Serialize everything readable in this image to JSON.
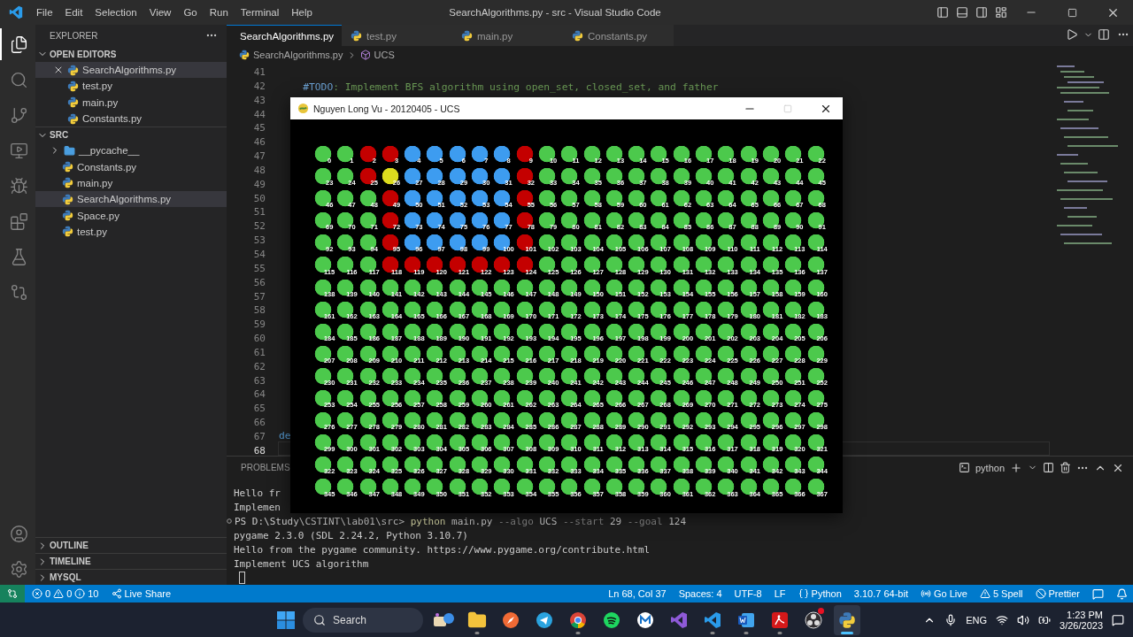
{
  "window": {
    "title": "SearchAlgorithms.py - src - Visual Studio Code"
  },
  "menu": [
    "File",
    "Edit",
    "Selection",
    "View",
    "Go",
    "Run",
    "Terminal",
    "Help"
  ],
  "activity_bar": [
    {
      "kind": "explorer",
      "selected": true
    },
    {
      "kind": "search",
      "selected": false
    },
    {
      "kind": "source-control",
      "selected": false
    },
    {
      "kind": "remote",
      "selected": false
    },
    {
      "kind": "debug",
      "selected": false
    },
    {
      "kind": "extensions",
      "selected": false
    },
    {
      "kind": "testing",
      "selected": false
    },
    {
      "kind": "git",
      "selected": false
    }
  ],
  "activity_bottom": [
    {
      "kind": "account"
    },
    {
      "kind": "settings"
    }
  ],
  "sidebar": {
    "title": "EXPLORER",
    "sections": [
      {
        "title": "OPEN EDITORS",
        "expanded": true,
        "items": [
          {
            "label": "SearchAlgorithms.py",
            "kind": "file",
            "selected": true,
            "closable": true
          },
          {
            "label": "test.py",
            "kind": "file",
            "selected": false,
            "closable": false
          },
          {
            "label": "main.py",
            "kind": "file",
            "selected": false,
            "closable": false
          },
          {
            "label": "Constants.py",
            "kind": "file",
            "selected": false,
            "closable": false
          }
        ]
      },
      {
        "title": "SRC",
        "expanded": true,
        "items": [
          {
            "label": "__pycache__",
            "kind": "folder",
            "selected": false,
            "closable": false
          },
          {
            "label": "Constants.py",
            "kind": "file",
            "selected": false,
            "closable": false
          },
          {
            "label": "main.py",
            "kind": "file",
            "selected": false,
            "closable": false
          },
          {
            "label": "SearchAlgorithms.py",
            "kind": "file",
            "selected": true,
            "closable": false
          },
          {
            "label": "Space.py",
            "kind": "file",
            "selected": false,
            "closable": false
          },
          {
            "label": "test.py",
            "kind": "file",
            "selected": false,
            "closable": false
          }
        ]
      }
    ],
    "bottom_sections": [
      {
        "title": "OUTLINE",
        "expanded": false
      },
      {
        "title": "TIMELINE",
        "expanded": false
      },
      {
        "title": "MYSQL",
        "expanded": false
      }
    ]
  },
  "tabs": [
    {
      "label": "SearchAlgorithms.py",
      "selected": true
    },
    {
      "label": "test.py",
      "selected": false
    },
    {
      "label": "main.py",
      "selected": false
    },
    {
      "label": "Constants.py",
      "selected": false
    }
  ],
  "breadcrumb": {
    "file": "SearchAlgorithms.py",
    "symbol": "UCS"
  },
  "code_lines": [
    {
      "number": "41",
      "current": false
    },
    {
      "number": "42",
      "current": false,
      "segments": [
        {
          "text": "    #TODO",
          "kind": "todo"
        },
        {
          "text": ": Implement BFS algorithm using open_set, closed_set, and father",
          "kind": "comment"
        }
      ]
    },
    {
      "number": "43",
      "current": false
    },
    {
      "number": "44",
      "current": false
    },
    {
      "number": "45",
      "current": false
    },
    {
      "number": "46",
      "current": false
    },
    {
      "number": "47",
      "current": false
    },
    {
      "number": "48",
      "current": false
    },
    {
      "number": "49",
      "current": false
    },
    {
      "number": "50",
      "current": false
    },
    {
      "number": "51",
      "current": false
    },
    {
      "number": "52",
      "current": false
    },
    {
      "number": "53",
      "current": false
    },
    {
      "number": "54",
      "current": false
    },
    {
      "number": "55",
      "current": false
    },
    {
      "number": "56",
      "current": false
    },
    {
      "number": "57",
      "current": false
    },
    {
      "number": "58",
      "current": false
    },
    {
      "number": "59",
      "current": false
    },
    {
      "number": "60",
      "current": false
    },
    {
      "number": "61",
      "current": false
    },
    {
      "number": "62",
      "current": false
    },
    {
      "number": "63",
      "current": false
    },
    {
      "number": "64",
      "current": false
    },
    {
      "number": "65",
      "current": false
    },
    {
      "number": "66",
      "current": false
    },
    {
      "number": "67",
      "current": false,
      "segments": [
        {
          "text": "de",
          "kind": "keyword"
        }
      ]
    },
    {
      "number": "68",
      "current": true
    }
  ],
  "panel": {
    "tabs": [
      {
        "label": "PROBLEMS",
        "selected": false
      }
    ],
    "terminal_name": "python",
    "lines": [
      {
        "kind": "plain",
        "segments": [
          {
            "text": "Hello fr",
            "kind": "plain"
          }
        ]
      },
      {
        "kind": "plain",
        "segments": [
          {
            "text": "Implemen",
            "kind": "plain"
          }
        ]
      },
      {
        "kind": "prompt",
        "segments": [
          {
            "text": "PS D:\\Study\\CSTINT\\lab01\\src> ",
            "kind": "plain"
          },
          {
            "text": "python",
            "kind": "command"
          },
          {
            "text": " main.py ",
            "kind": "plain"
          },
          {
            "text": "--algo",
            "kind": "flag"
          },
          {
            "text": " UCS ",
            "kind": "plain"
          },
          {
            "text": "--start",
            "kind": "flag"
          },
          {
            "text": " 29 ",
            "kind": "plain"
          },
          {
            "text": "--goal",
            "kind": "flag"
          },
          {
            "text": " 124",
            "kind": "plain"
          }
        ]
      },
      {
        "kind": "plain",
        "segments": [
          {
            "text": "pygame 2.3.0 (SDL 2.24.2, Python 3.10.7)",
            "kind": "plain"
          }
        ]
      },
      {
        "kind": "plain",
        "segments": [
          {
            "text": "Hello from the pygame community. https://www.pygame.org/contribute.html",
            "kind": "plain"
          }
        ]
      },
      {
        "kind": "plain",
        "segments": [
          {
            "text": "Implement UCS algorithm",
            "kind": "plain"
          }
        ]
      },
      {
        "kind": "cursor"
      }
    ]
  },
  "status_bar": {
    "left": [
      {
        "kind": "remote"
      },
      {
        "kind": "problems",
        "errors": "0",
        "warnings": "0",
        "infos": "10"
      },
      {
        "kind": "liveshare",
        "text": "Live Share"
      }
    ],
    "right": [
      {
        "kind": "text",
        "text": "Ln 68, Col 37"
      },
      {
        "kind": "text",
        "text": "Spaces: 4"
      },
      {
        "kind": "text",
        "text": "UTF-8"
      },
      {
        "kind": "text",
        "text": "LF"
      },
      {
        "kind": "language",
        "text": "Python"
      },
      {
        "kind": "text",
        "text": "3.10.7 64-bit"
      },
      {
        "kind": "golive",
        "text": "Go Live"
      },
      {
        "kind": "spell",
        "text": "5 Spell"
      },
      {
        "kind": "prettier",
        "text": "Prettier"
      },
      {
        "kind": "feedback"
      },
      {
        "kind": "bell"
      }
    ]
  },
  "taskbar": {
    "search": {
      "placeholder": "Search"
    },
    "apps": [
      {
        "kind": "widgets",
        "running": false,
        "selected": false,
        "badge": false
      },
      {
        "kind": "files",
        "running": true,
        "selected": false,
        "badge": false
      },
      {
        "kind": "compass",
        "running": false,
        "selected": false,
        "badge": false
      },
      {
        "kind": "telegram",
        "running": false,
        "selected": false,
        "badge": false
      },
      {
        "kind": "chrome",
        "running": true,
        "selected": false,
        "badge": false
      },
      {
        "kind": "spotify",
        "running": false,
        "selected": false,
        "badge": false
      },
      {
        "kind": "mail",
        "running": false,
        "selected": false,
        "badge": false
      },
      {
        "kind": "visual-studio",
        "running": false,
        "selected": false,
        "badge": false
      },
      {
        "kind": "vscode",
        "running": true,
        "selected": false,
        "badge": false
      },
      {
        "kind": "word",
        "running": true,
        "selected": false,
        "badge": false
      },
      {
        "kind": "acrobat",
        "running": true,
        "selected": false,
        "badge": false
      },
      {
        "kind": "obs",
        "running": false,
        "selected": false,
        "badge": true
      },
      {
        "kind": "python",
        "running": true,
        "selected": true,
        "badge": false
      }
    ],
    "language": "ENG",
    "time": "1:23 PM",
    "date": "3/26/2023"
  },
  "pygame_window": {
    "title": "Nguyen Long Vu - 20120405 - UCS",
    "buttons": [
      {
        "kind": "minimize",
        "disabled": false
      },
      {
        "kind": "maximize",
        "disabled": true
      },
      {
        "kind": "close",
        "disabled": false
      }
    ],
    "nodes": [
      {
        "label": "0",
        "color": "#4cc94c"
      },
      {
        "label": "1",
        "color": "#4cc94c"
      },
      {
        "label": "2",
        "color": "#c40000"
      },
      {
        "label": "3",
        "color": "#c40000"
      },
      {
        "label": "4",
        "color": "#3d9cf0"
      },
      {
        "label": "5",
        "color": "#3d9cf0"
      },
      {
        "label": "6",
        "color": "#3d9cf0"
      },
      {
        "label": "7",
        "color": "#3d9cf0"
      },
      {
        "label": "8",
        "color": "#3d9cf0"
      },
      {
        "label": "9",
        "color": "#c40000"
      },
      {
        "label": "10",
        "color": "#4cc94c"
      },
      {
        "label": "11",
        "color": "#4cc94c"
      },
      {
        "label": "12",
        "color": "#4cc94c"
      },
      {
        "label": "13",
        "color": "#4cc94c"
      },
      {
        "label": "14",
        "color": "#4cc94c"
      },
      {
        "label": "15",
        "color": "#4cc94c"
      },
      {
        "label": "16",
        "color": "#4cc94c"
      },
      {
        "label": "17",
        "color": "#4cc94c"
      },
      {
        "label": "18",
        "color": "#4cc94c"
      },
      {
        "label": "19",
        "color": "#4cc94c"
      },
      {
        "label": "20",
        "color": "#4cc94c"
      },
      {
        "label": "21",
        "color": "#4cc94c"
      },
      {
        "label": "22",
        "color": "#4cc94c"
      },
      {
        "label": "23",
        "color": "#4cc94c"
      },
      {
        "label": "24",
        "color": "#4cc94c"
      },
      {
        "label": "25",
        "color": "#c40000"
      },
      {
        "label": "26",
        "color": "#dcdc1e"
      },
      {
        "label": "27",
        "color": "#3d9cf0"
      },
      {
        "label": "28",
        "color": "#3d9cf0"
      },
      {
        "label": "29",
        "color": "#3d9cf0"
      },
      {
        "label": "30",
        "color": "#3d9cf0"
      },
      {
        "label": "31",
        "color": "#3d9cf0"
      },
      {
        "label": "32",
        "color": "#c40000"
      },
      {
        "label": "33",
        "color": "#4cc94c"
      },
      {
        "label": "34",
        "color": "#4cc94c"
      },
      {
        "label": "35",
        "color": "#4cc94c"
      },
      {
        "label": "36",
        "color": "#4cc94c"
      },
      {
        "label": "37",
        "color": "#4cc94c"
      },
      {
        "label": "38",
        "color": "#4cc94c"
      },
      {
        "label": "39",
        "color": "#4cc94c"
      },
      {
        "label": "40",
        "color": "#4cc94c"
      },
      {
        "label": "41",
        "color": "#4cc94c"
      },
      {
        "label": "42",
        "color": "#4cc94c"
      },
      {
        "label": "43",
        "color": "#4cc94c"
      },
      {
        "label": "44",
        "color": "#4cc94c"
      },
      {
        "label": "45",
        "color": "#4cc94c"
      },
      {
        "label": "46",
        "color": "#4cc94c"
      },
      {
        "label": "47",
        "color": "#4cc94c"
      },
      {
        "label": "48",
        "color": "#4cc94c"
      },
      {
        "label": "49",
        "color": "#c40000"
      },
      {
        "label": "50",
        "color": "#3d9cf0"
      },
      {
        "label": "51",
        "color": "#3d9cf0"
      },
      {
        "label": "52",
        "color": "#3d9cf0"
      },
      {
        "label": "53",
        "color": "#3d9cf0"
      },
      {
        "label": "54",
        "color": "#3d9cf0"
      },
      {
        "label": "55",
        "color": "#c40000"
      },
      {
        "label": "56",
        "color": "#4cc94c"
      },
      {
        "label": "57",
        "color": "#4cc94c"
      },
      {
        "label": "58",
        "color": "#4cc94c"
      },
      {
        "label": "59",
        "color": "#4cc94c"
      },
      {
        "label": "60",
        "color": "#4cc94c"
      },
      {
        "label": "61",
        "color": "#4cc94c"
      },
      {
        "label": "62",
        "color": "#4cc94c"
      },
      {
        "label": "63",
        "color": "#4cc94c"
      },
      {
        "label": "64",
        "color": "#4cc94c"
      },
      {
        "label": "65",
        "color": "#4cc94c"
      },
      {
        "label": "66",
        "color": "#4cc94c"
      },
      {
        "label": "67",
        "color": "#4cc94c"
      },
      {
        "label": "68",
        "color": "#4cc94c"
      },
      {
        "label": "69",
        "color": "#4cc94c"
      },
      {
        "label": "70",
        "color": "#4cc94c"
      },
      {
        "label": "71",
        "color": "#4cc94c"
      },
      {
        "label": "72",
        "color": "#c40000"
      },
      {
        "label": "73",
        "color": "#3d9cf0"
      },
      {
        "label": "74",
        "color": "#3d9cf0"
      },
      {
        "label": "75",
        "color": "#3d9cf0"
      },
      {
        "label": "76",
        "color": "#3d9cf0"
      },
      {
        "label": "77",
        "color": "#3d9cf0"
      },
      {
        "label": "78",
        "color": "#c40000"
      },
      {
        "label": "79",
        "color": "#4cc94c"
      },
      {
        "label": "80",
        "color": "#4cc94c"
      },
      {
        "label": "81",
        "color": "#4cc94c"
      },
      {
        "label": "82",
        "color": "#4cc94c"
      },
      {
        "label": "83",
        "color": "#4cc94c"
      },
      {
        "label": "84",
        "color": "#4cc94c"
      },
      {
        "label": "85",
        "color": "#4cc94c"
      },
      {
        "label": "86",
        "color": "#4cc94c"
      },
      {
        "label": "87",
        "color": "#4cc94c"
      },
      {
        "label": "88",
        "color": "#4cc94c"
      },
      {
        "label": "89",
        "color": "#4cc94c"
      },
      {
        "label": "90",
        "color": "#4cc94c"
      },
      {
        "label": "91",
        "color": "#4cc94c"
      },
      {
        "label": "92",
        "color": "#4cc94c"
      },
      {
        "label": "93",
        "color": "#4cc94c"
      },
      {
        "label": "94",
        "color": "#4cc94c"
      },
      {
        "label": "95",
        "color": "#c40000"
      },
      {
        "label": "96",
        "color": "#3d9cf0"
      },
      {
        "label": "97",
        "color": "#3d9cf0"
      },
      {
        "label": "98",
        "color": "#3d9cf0"
      },
      {
        "label": "99",
        "color": "#3d9cf0"
      },
      {
        "label": "100",
        "color": "#3d9cf0"
      },
      {
        "label": "101",
        "color": "#c40000"
      },
      {
        "label": "102",
        "color": "#4cc94c"
      },
      {
        "label": "103",
        "color": "#4cc94c"
      },
      {
        "label": "104",
        "color": "#4cc94c"
      },
      {
        "label": "105",
        "color": "#4cc94c"
      },
      {
        "label": "106",
        "color": "#4cc94c"
      },
      {
        "label": "107",
        "color": "#4cc94c"
      },
      {
        "label": "108",
        "color": "#4cc94c"
      },
      {
        "label": "109",
        "color": "#4cc94c"
      },
      {
        "label": "110",
        "color": "#4cc94c"
      },
      {
        "label": "111",
        "color": "#4cc94c"
      },
      {
        "label": "112",
        "color": "#4cc94c"
      },
      {
        "label": "113",
        "color": "#4cc94c"
      },
      {
        "label": "114",
        "color": "#4cc94c"
      },
      {
        "label": "115",
        "color": "#4cc94c"
      },
      {
        "label": "116",
        "color": "#4cc94c"
      },
      {
        "label": "117",
        "color": "#4cc94c"
      },
      {
        "label": "118",
        "color": "#c40000"
      },
      {
        "label": "119",
        "color": "#c40000"
      },
      {
        "label": "120",
        "color": "#c40000"
      },
      {
        "label": "121",
        "color": "#c40000"
      },
      {
        "label": "122",
        "color": "#c40000"
      },
      {
        "label": "123",
        "color": "#c40000"
      },
      {
        "label": "124",
        "color": "#c40000"
      },
      {
        "label": "125",
        "color": "#4cc94c"
      },
      {
        "label": "126",
        "color": "#4cc94c"
      },
      {
        "label": "127",
        "color": "#4cc94c"
      },
      {
        "label": "128",
        "color": "#4cc94c"
      },
      {
        "label": "129",
        "color": "#4cc94c"
      },
      {
        "label": "130",
        "color": "#4cc94c"
      },
      {
        "label": "131",
        "color": "#4cc94c"
      },
      {
        "label": "132",
        "color": "#4cc94c"
      },
      {
        "label": "133",
        "color": "#4cc94c"
      },
      {
        "label": "134",
        "color": "#4cc94c"
      },
      {
        "label": "135",
        "color": "#4cc94c"
      },
      {
        "label": "136",
        "color": "#4cc94c"
      },
      {
        "label": "137",
        "color": "#4cc94c"
      },
      {
        "label": "138",
        "color": "#4cc94c"
      },
      {
        "label": "139",
        "color": "#4cc94c"
      },
      {
        "label": "140",
        "color": "#4cc94c"
      },
      {
        "label": "141",
        "color": "#4cc94c"
      },
      {
        "label": "142",
        "color": "#4cc94c"
      },
      {
        "label": "143",
        "color": "#4cc94c"
      },
      {
        "label": "144",
        "color": "#4cc94c"
      },
      {
        "label": "145",
        "color": "#4cc94c"
      },
      {
        "label": "146",
        "color": "#4cc94c"
      },
      {
        "label": "147",
        "color": "#4cc94c"
      },
      {
        "label": "148",
        "color": "#4cc94c"
      },
      {
        "label": "149",
        "color": "#4cc94c"
      },
      {
        "label": "150",
        "color": "#4cc94c"
      },
      {
        "label": "151",
        "color": "#4cc94c"
      },
      {
        "label": "152",
        "color": "#4cc94c"
      },
      {
        "label": "153",
        "color": "#4cc94c"
      },
      {
        "label": "154",
        "color": "#4cc94c"
      },
      {
        "label": "155",
        "color": "#4cc94c"
      },
      {
        "label": "156",
        "color": "#4cc94c"
      },
      {
        "label": "157",
        "color": "#4cc94c"
      },
      {
        "label": "158",
        "color": "#4cc94c"
      },
      {
        "label": "159",
        "color": "#4cc94c"
      },
      {
        "label": "160",
        "color": "#4cc94c"
      },
      {
        "label": "161",
        "color": "#4cc94c"
      },
      {
        "label": "162",
        "color": "#4cc94c"
      },
      {
        "label": "163",
        "color": "#4cc94c"
      },
      {
        "label": "164",
        "color": "#4cc94c"
      },
      {
        "label": "165",
        "color": "#4cc94c"
      },
      {
        "label": "166",
        "color": "#4cc94c"
      },
      {
        "label": "167",
        "color": "#4cc94c"
      },
      {
        "label": "168",
        "color": "#4cc94c"
      },
      {
        "label": "169",
        "color": "#4cc94c"
      },
      {
        "label": "170",
        "color": "#4cc94c"
      },
      {
        "label": "171",
        "color": "#4cc94c"
      },
      {
        "label": "172",
        "color": "#4cc94c"
      },
      {
        "label": "173",
        "color": "#4cc94c"
      },
      {
        "label": "174",
        "color": "#4cc94c"
      },
      {
        "label": "175",
        "color": "#4cc94c"
      },
      {
        "label": "176",
        "color": "#4cc94c"
      },
      {
        "label": "177",
        "color": "#4cc94c"
      },
      {
        "label": "178",
        "color": "#4cc94c"
      },
      {
        "label": "179",
        "color": "#4cc94c"
      },
      {
        "label": "180",
        "color": "#4cc94c"
      },
      {
        "label": "181",
        "color": "#4cc94c"
      },
      {
        "label": "182",
        "color": "#4cc94c"
      },
      {
        "label": "183",
        "color": "#4cc94c"
      },
      {
        "label": "184",
        "color": "#4cc94c"
      },
      {
        "label": "185",
        "color": "#4cc94c"
      },
      {
        "label": "186",
        "color": "#4cc94c"
      },
      {
        "label": "187",
        "color": "#4cc94c"
      },
      {
        "label": "188",
        "color": "#4cc94c"
      },
      {
        "label": "189",
        "color": "#4cc94c"
      },
      {
        "label": "190",
        "color": "#4cc94c"
      },
      {
        "label": "191",
        "color": "#4cc94c"
      },
      {
        "label": "192",
        "color": "#4cc94c"
      },
      {
        "label": "193",
        "color": "#4cc94c"
      },
      {
        "label": "194",
        "color": "#4cc94c"
      },
      {
        "label": "195",
        "color": "#4cc94c"
      },
      {
        "label": "196",
        "color": "#4cc94c"
      },
      {
        "label": "197",
        "color": "#4cc94c"
      },
      {
        "label": "198",
        "color": "#4cc94c"
      },
      {
        "label": "199",
        "color": "#4cc94c"
      },
      {
        "label": "200",
        "color": "#4cc94c"
      },
      {
        "label": "201",
        "color": "#4cc94c"
      },
      {
        "label": "202",
        "color": "#4cc94c"
      },
      {
        "label": "203",
        "color": "#4cc94c"
      },
      {
        "label": "204",
        "color": "#4cc94c"
      },
      {
        "label": "205",
        "color": "#4cc94c"
      },
      {
        "label": "206",
        "color": "#4cc94c"
      },
      {
        "label": "207",
        "color": "#4cc94c"
      },
      {
        "label": "208",
        "color": "#4cc94c"
      },
      {
        "label": "209",
        "color": "#4cc94c"
      },
      {
        "label": "210",
        "color": "#4cc94c"
      },
      {
        "label": "211",
        "color": "#4cc94c"
      },
      {
        "label": "212",
        "color": "#4cc94c"
      },
      {
        "label": "213",
        "color": "#4cc94c"
      },
      {
        "label": "214",
        "color": "#4cc94c"
      },
      {
        "label": "215",
        "color": "#4cc94c"
      },
      {
        "label": "216",
        "color": "#4cc94c"
      },
      {
        "label": "217",
        "color": "#4cc94c"
      },
      {
        "label": "218",
        "color": "#4cc94c"
      },
      {
        "label": "219",
        "color": "#4cc94c"
      },
      {
        "label": "220",
        "color": "#4cc94c"
      },
      {
        "label": "221",
        "color": "#4cc94c"
      },
      {
        "label": "222",
        "color": "#4cc94c"
      },
      {
        "label": "223",
        "color": "#4cc94c"
      },
      {
        "label": "224",
        "color": "#4cc94c"
      },
      {
        "label": "225",
        "color": "#4cc94c"
      },
      {
        "label": "226",
        "color": "#4cc94c"
      },
      {
        "label": "227",
        "color": "#4cc94c"
      },
      {
        "label": "228",
        "color": "#4cc94c"
      },
      {
        "label": "229",
        "color": "#4cc94c"
      },
      {
        "label": "230",
        "color": "#4cc94c"
      },
      {
        "label": "231",
        "color": "#4cc94c"
      },
      {
        "label": "232",
        "color": "#4cc94c"
      },
      {
        "label": "233",
        "color": "#4cc94c"
      },
      {
        "label": "234",
        "color": "#4cc94c"
      },
      {
        "label": "235",
        "color": "#4cc94c"
      },
      {
        "label": "236",
        "color": "#4cc94c"
      },
      {
        "label": "237",
        "color": "#4cc94c"
      },
      {
        "label": "238",
        "color": "#4cc94c"
      },
      {
        "label": "239",
        "color": "#4cc94c"
      },
      {
        "label": "240",
        "color": "#4cc94c"
      },
      {
        "label": "241",
        "color": "#4cc94c"
      },
      {
        "label": "242",
        "color": "#4cc94c"
      },
      {
        "label": "243",
        "color": "#4cc94c"
      },
      {
        "label": "244",
        "color": "#4cc94c"
      },
      {
        "label": "245",
        "color": "#4cc94c"
      },
      {
        "label": "246",
        "color": "#4cc94c"
      },
      {
        "label": "247",
        "color": "#4cc94c"
      },
      {
        "label": "248",
        "color": "#4cc94c"
      },
      {
        "label": "249",
        "color": "#4cc94c"
      },
      {
        "label": "250",
        "color": "#4cc94c"
      },
      {
        "label": "251",
        "color": "#4cc94c"
      },
      {
        "label": "252",
        "color": "#4cc94c"
      },
      {
        "label": "253",
        "color": "#4cc94c"
      },
      {
        "label": "254",
        "color": "#4cc94c"
      },
      {
        "label": "255",
        "color": "#4cc94c"
      },
      {
        "label": "256",
        "color": "#4cc94c"
      },
      {
        "label": "257",
        "color": "#4cc94c"
      },
      {
        "label": "258",
        "color": "#4cc94c"
      },
      {
        "label": "259",
        "color": "#4cc94c"
      },
      {
        "label": "260",
        "color": "#4cc94c"
      },
      {
        "label": "261",
        "color": "#4cc94c"
      },
      {
        "label": "262",
        "color": "#4cc94c"
      },
      {
        "label": "263",
        "color": "#4cc94c"
      },
      {
        "label": "264",
        "color": "#4cc94c"
      },
      {
        "label": "265",
        "color": "#4cc94c"
      },
      {
        "label": "266",
        "color": "#4cc94c"
      },
      {
        "label": "267",
        "color": "#4cc94c"
      },
      {
        "label": "268",
        "color": "#4cc94c"
      },
      {
        "label": "269",
        "color": "#4cc94c"
      },
      {
        "label": "270",
        "color": "#4cc94c"
      },
      {
        "label": "271",
        "color": "#4cc94c"
      },
      {
        "label": "272",
        "color": "#4cc94c"
      },
      {
        "label": "273",
        "color": "#4cc94c"
      },
      {
        "label": "274",
        "color": "#4cc94c"
      },
      {
        "label": "275",
        "color": "#4cc94c"
      },
      {
        "label": "276",
        "color": "#4cc94c"
      },
      {
        "label": "277",
        "color": "#4cc94c"
      },
      {
        "label": "278",
        "color": "#4cc94c"
      },
      {
        "label": "279",
        "color": "#4cc94c"
      },
      {
        "label": "280",
        "color": "#4cc94c"
      },
      {
        "label": "281",
        "color": "#4cc94c"
      },
      {
        "label": "282",
        "color": "#4cc94c"
      },
      {
        "label": "283",
        "color": "#4cc94c"
      },
      {
        "label": "284",
        "color": "#4cc94c"
      },
      {
        "label": "285",
        "color": "#4cc94c"
      },
      {
        "label": "286",
        "color": "#4cc94c"
      },
      {
        "label": "287",
        "color": "#4cc94c"
      },
      {
        "label": "288",
        "color": "#4cc94c"
      },
      {
        "label": "289",
        "color": "#4cc94c"
      },
      {
        "label": "290",
        "color": "#4cc94c"
      },
      {
        "label": "291",
        "color": "#4cc94c"
      },
      {
        "label": "292",
        "color": "#4cc94c"
      },
      {
        "label": "293",
        "color": "#4cc94c"
      },
      {
        "label": "294",
        "color": "#4cc94c"
      },
      {
        "label": "295",
        "color": "#4cc94c"
      },
      {
        "label": "296",
        "color": "#4cc94c"
      },
      {
        "label": "297",
        "color": "#4cc94c"
      },
      {
        "label": "298",
        "color": "#4cc94c"
      },
      {
        "label": "299",
        "color": "#4cc94c"
      },
      {
        "label": "300",
        "color": "#4cc94c"
      },
      {
        "label": "301",
        "color": "#4cc94c"
      },
      {
        "label": "302",
        "color": "#4cc94c"
      },
      {
        "label": "303",
        "color": "#4cc94c"
      },
      {
        "label": "304",
        "color": "#4cc94c"
      },
      {
        "label": "305",
        "color": "#4cc94c"
      },
      {
        "label": "306",
        "color": "#4cc94c"
      },
      {
        "label": "307",
        "color": "#4cc94c"
      },
      {
        "label": "308",
        "color": "#4cc94c"
      },
      {
        "label": "309",
        "color": "#4cc94c"
      },
      {
        "label": "310",
        "color": "#4cc94c"
      },
      {
        "label": "311",
        "color": "#4cc94c"
      },
      {
        "label": "312",
        "color": "#4cc94c"
      },
      {
        "label": "313",
        "color": "#4cc94c"
      },
      {
        "label": "314",
        "color": "#4cc94c"
      },
      {
        "label": "315",
        "color": "#4cc94c"
      },
      {
        "label": "316",
        "color": "#4cc94c"
      },
      {
        "label": "317",
        "color": "#4cc94c"
      },
      {
        "label": "318",
        "color": "#4cc94c"
      },
      {
        "label": "319",
        "color": "#4cc94c"
      },
      {
        "label": "320",
        "color": "#4cc94c"
      },
      {
        "label": "321",
        "color": "#4cc94c"
      },
      {
        "label": "322",
        "color": "#4cc94c"
      },
      {
        "label": "323",
        "color": "#4cc94c"
      },
      {
        "label": "324",
        "color": "#4cc94c"
      },
      {
        "label": "325",
        "color": "#4cc94c"
      },
      {
        "label": "326",
        "color": "#4cc94c"
      },
      {
        "label": "327",
        "color": "#4cc94c"
      },
      {
        "label": "328",
        "color": "#4cc94c"
      },
      {
        "label": "329",
        "color": "#4cc94c"
      },
      {
        "label": "330",
        "color": "#4cc94c"
      },
      {
        "label": "331",
        "color": "#4cc94c"
      },
      {
        "label": "332",
        "color": "#4cc94c"
      },
      {
        "label": "333",
        "color": "#4cc94c"
      },
      {
        "label": "334",
        "color": "#4cc94c"
      },
      {
        "label": "335",
        "color": "#4cc94c"
      },
      {
        "label": "336",
        "color": "#4cc94c"
      },
      {
        "label": "337",
        "color": "#4cc94c"
      },
      {
        "label": "338",
        "color": "#4cc94c"
      },
      {
        "label": "339",
        "color": "#4cc94c"
      },
      {
        "label": "340",
        "color": "#4cc94c"
      },
      {
        "label": "341",
        "color": "#4cc94c"
      },
      {
        "label": "342",
        "color": "#4cc94c"
      },
      {
        "label": "343",
        "color": "#4cc94c"
      },
      {
        "label": "344",
        "color": "#4cc94c"
      },
      {
        "label": "345",
        "color": "#4cc94c"
      },
      {
        "label": "346",
        "color": "#4cc94c"
      },
      {
        "label": "347",
        "color": "#4cc94c"
      },
      {
        "label": "348",
        "color": "#4cc94c"
      },
      {
        "label": "349",
        "color": "#4cc94c"
      },
      {
        "label": "350",
        "color": "#4cc94c"
      },
      {
        "label": "351",
        "color": "#4cc94c"
      },
      {
        "label": "352",
        "color": "#4cc94c"
      },
      {
        "label": "353",
        "color": "#4cc94c"
      },
      {
        "label": "354",
        "color": "#4cc94c"
      },
      {
        "label": "355",
        "color": "#4cc94c"
      },
      {
        "label": "356",
        "color": "#4cc94c"
      },
      {
        "label": "357",
        "color": "#4cc94c"
      },
      {
        "label": "358",
        "color": "#4cc94c"
      },
      {
        "label": "359",
        "color": "#4cc94c"
      },
      {
        "label": "360",
        "color": "#4cc94c"
      },
      {
        "label": "361",
        "color": "#4cc94c"
      },
      {
        "label": "362",
        "color": "#4cc94c"
      },
      {
        "label": "363",
        "color": "#4cc94c"
      },
      {
        "label": "364",
        "color": "#4cc94c"
      },
      {
        "label": "365",
        "color": "#4cc94c"
      },
      {
        "label": "366",
        "color": "#4cc94c"
      },
      {
        "label": "367",
        "color": "#4cc94c"
      }
    ]
  }
}
